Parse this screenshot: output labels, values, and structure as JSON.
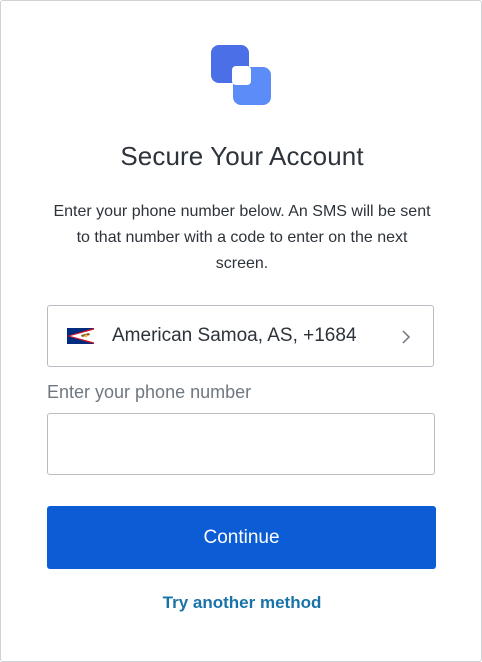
{
  "heading": "Secure Your Account",
  "description": "Enter your phone number below. An SMS will be sent to that number with a code to enter on the next screen.",
  "country_selector": {
    "label": "American Samoa, AS, +1684",
    "flag_icon": "american-samoa-flag-icon",
    "chevron_icon": "chevron-right-icon"
  },
  "phone": {
    "label": "Enter your phone number",
    "value": "",
    "placeholder": ""
  },
  "actions": {
    "continue_label": "Continue",
    "alternate_label": "Try another method"
  },
  "colors": {
    "primary": "#0b5cd5",
    "link": "#1a73a8",
    "logo_light": "#4f7df3",
    "logo_dark": "#3b5fe0"
  }
}
